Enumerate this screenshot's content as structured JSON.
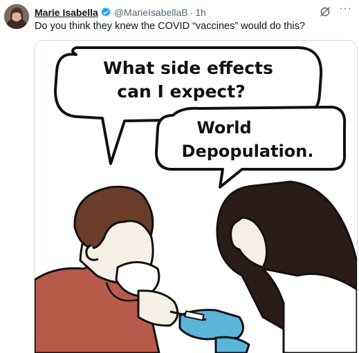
{
  "post": {
    "author_name": "Marie Isabella",
    "handle": "@MarieIsabellaB",
    "separator": "·",
    "time": "1h",
    "text": "Do you think they knew the COVID “vaccines” would do this?",
    "more_label": "···"
  },
  "cartoon": {
    "bubble1_line1": "What side effects",
    "bubble1_line2": "can I expect?",
    "bubble2_line1": "World",
    "bubble2_line2": "Depopulation."
  },
  "colors": {
    "verified": "#1d9bf0",
    "patient_shirt": "#b85a4a",
    "gloves": "#5bb5d9",
    "hair": "#6a3e2a",
    "nurse_hair": "#2a1c16"
  }
}
